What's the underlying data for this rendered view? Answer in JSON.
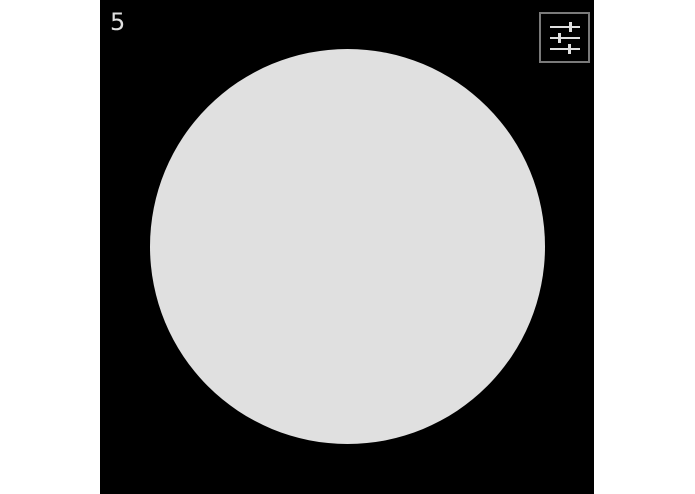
{
  "counter": {
    "value": "5"
  },
  "settings_button": {
    "icon": "sliders-icon"
  },
  "shape": {
    "type": "circle"
  },
  "colors": {
    "background": "#000000",
    "shape_fill": "#e0e0e0",
    "text": "#e0e0e0",
    "button_border": "#7a7a7a",
    "page": "#ffffff"
  }
}
